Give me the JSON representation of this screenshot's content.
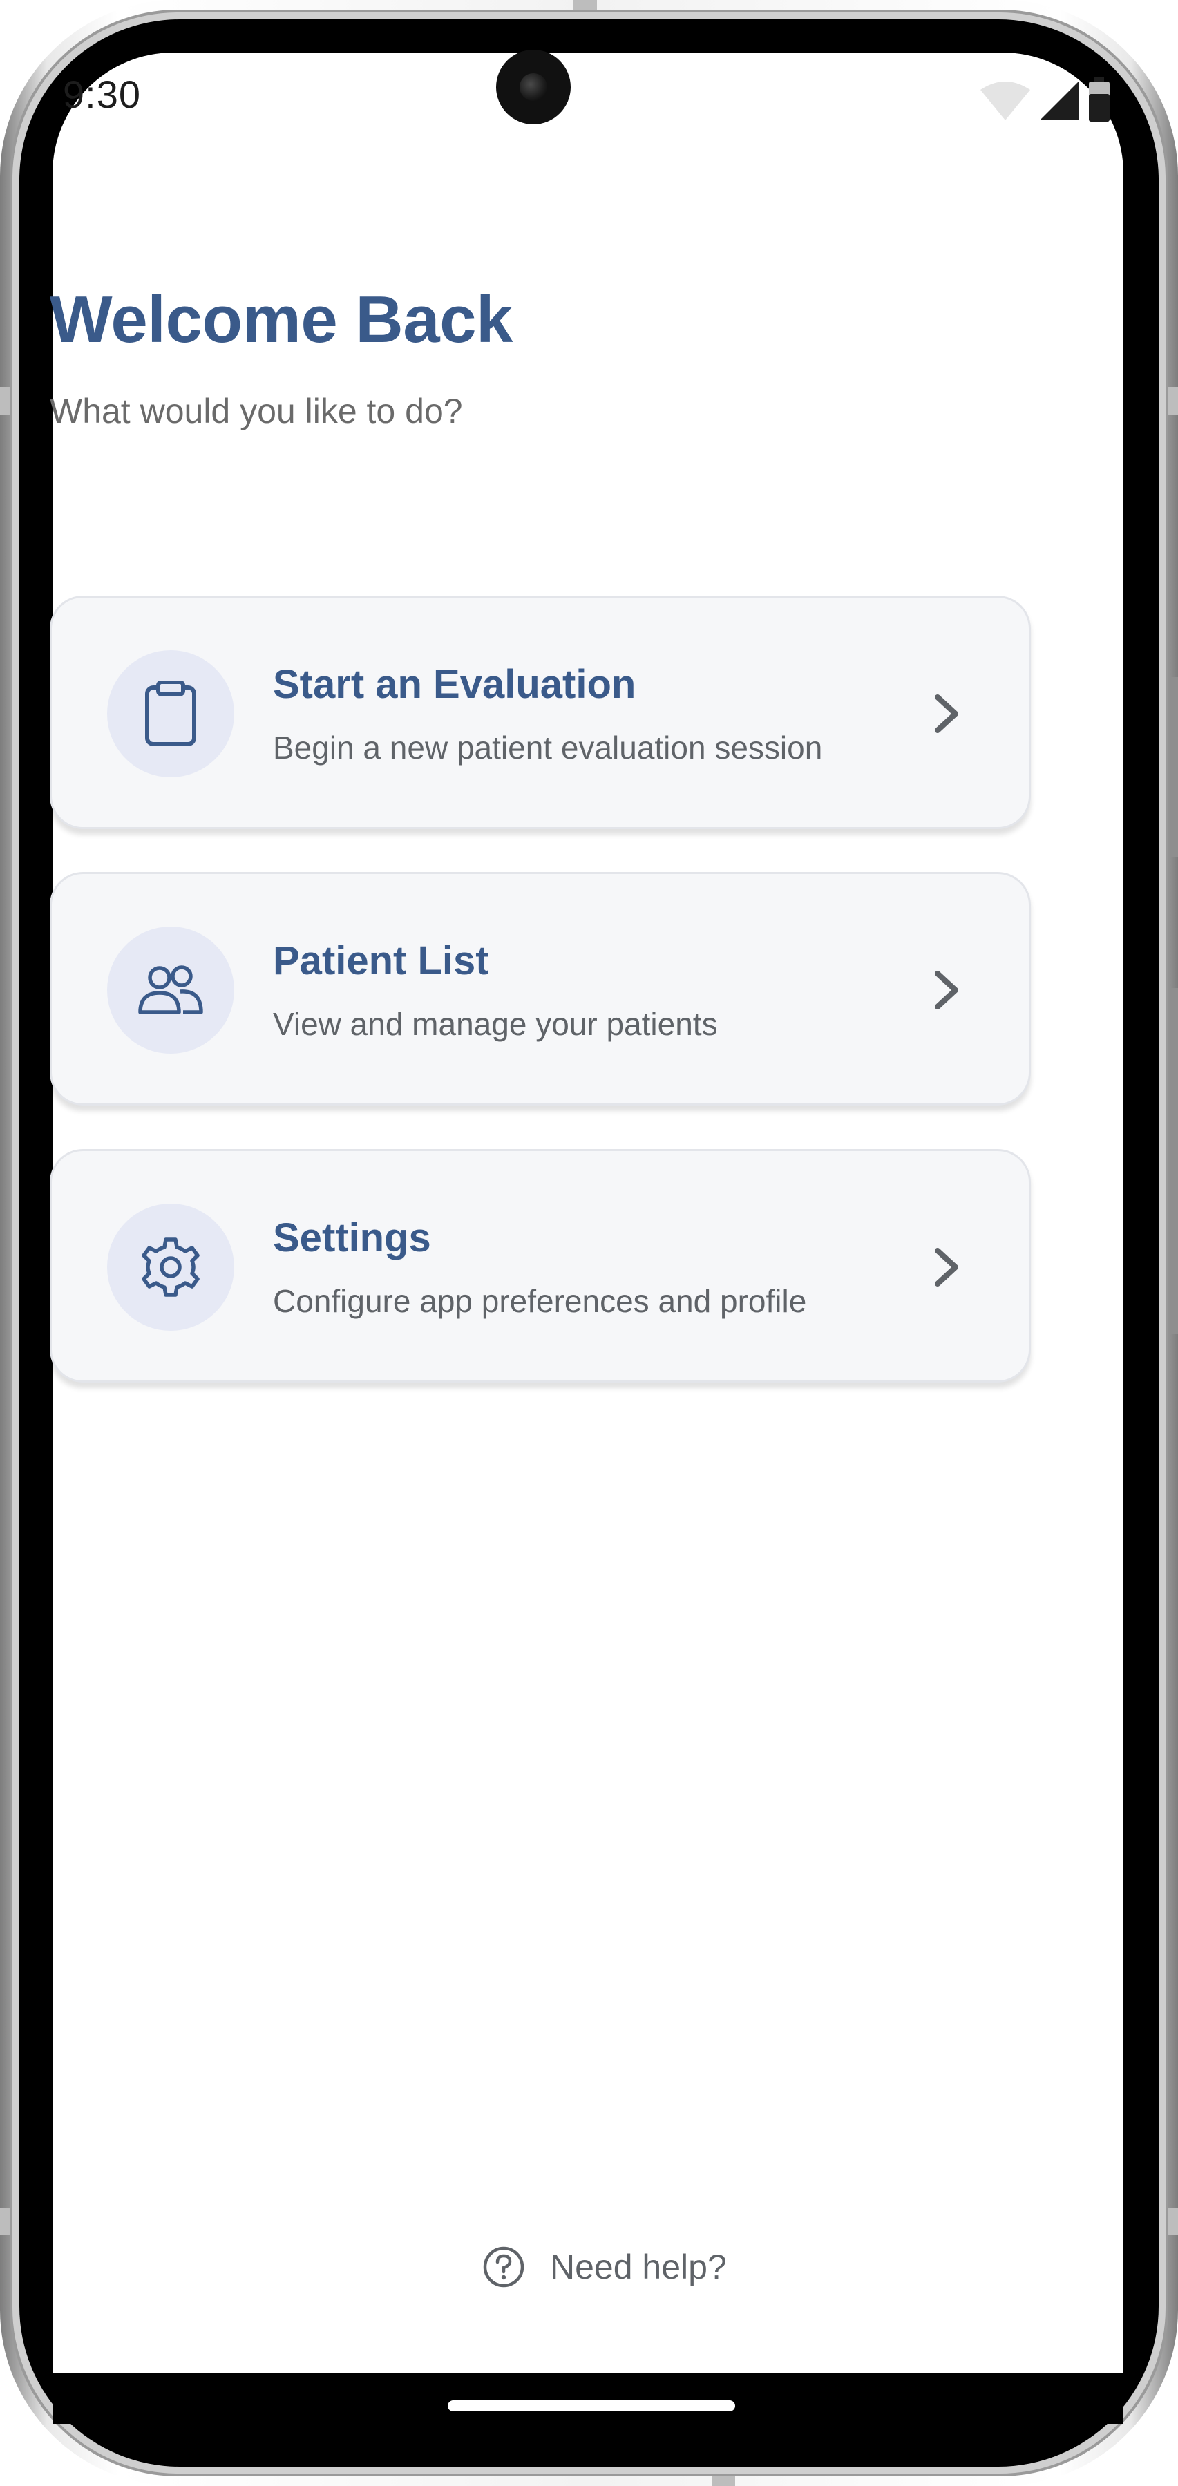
{
  "status_bar": {
    "time": "9:30",
    "icons": [
      "wifi-icon",
      "cellular-signal-icon",
      "battery-icon"
    ]
  },
  "header": {
    "title": "Welcome Back",
    "subtitle": "What would you like to do?"
  },
  "menu": {
    "items": [
      {
        "title": "Start an Evaluation",
        "description": "Begin a new patient evaluation session",
        "icon": "clipboard-icon"
      },
      {
        "title": "Patient List",
        "description": "View and manage your patients",
        "icon": "users-icon"
      },
      {
        "title": "Settings",
        "description": "Configure app preferences and profile",
        "icon": "gear-icon"
      }
    ]
  },
  "help": {
    "label": "Need help?",
    "icon": "question-circle-icon"
  },
  "colors": {
    "accent": "#3a5a8a",
    "card_background": "#f6f7f9",
    "icon_background": "#e6e9f5",
    "secondary_text": "#5f6368"
  }
}
